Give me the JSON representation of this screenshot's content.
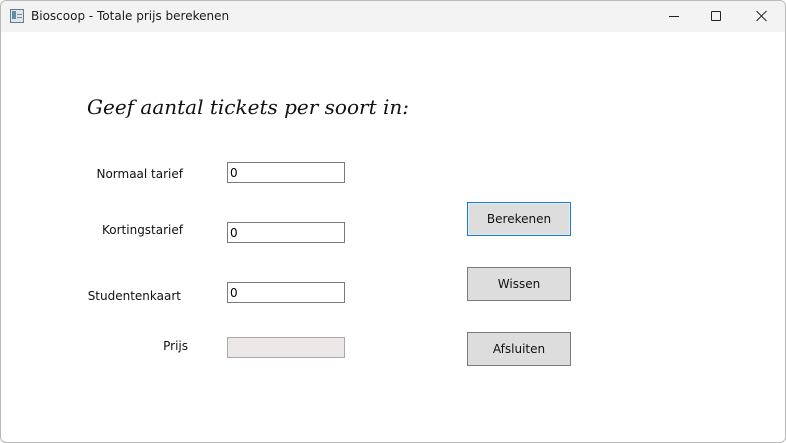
{
  "window": {
    "title": "Bioscoop - Totale prijs berekenen"
  },
  "heading": "Geef aantal tickets per soort in:",
  "fields": {
    "normaal": {
      "label": "Normaal tarief",
      "value": "0"
    },
    "korting": {
      "label": "Kortingstarief",
      "value": "0"
    },
    "student": {
      "label": "Studentenkaart",
      "value": "0"
    },
    "prijs": {
      "label": "Prijs",
      "value": ""
    }
  },
  "buttons": {
    "berekenen": "Berekenen",
    "wissen": "Wissen",
    "afsluiten": "Afsluiten"
  },
  "icons": {
    "app": "app-window-icon",
    "minimize": "minimize-icon",
    "maximize": "maximize-icon",
    "close": "close-icon"
  },
  "colors": {
    "titlebar": "#f3f3f3",
    "button_face": "#dddddd",
    "default_button_border": "#1f78c8",
    "readonly_field": "#ebe8e7"
  }
}
